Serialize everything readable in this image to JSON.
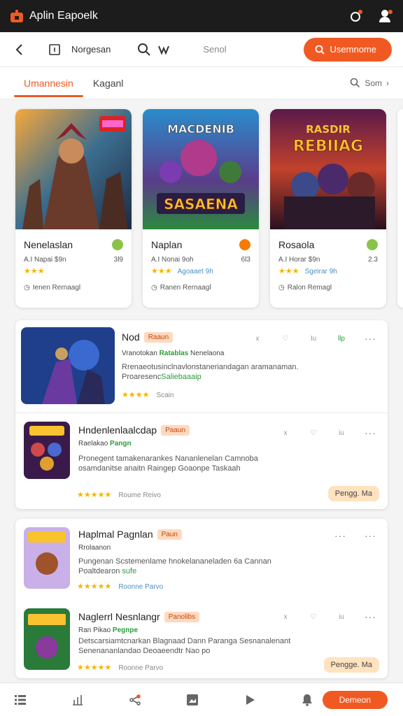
{
  "window": {
    "title": "Aplin Eapoelk",
    "icons": [
      "app-logo-icon",
      "share-icon",
      "user-icon"
    ]
  },
  "toolbar": {
    "nav_label": "Norgesan",
    "search_label": "Senol",
    "cta_label": "Usemnome"
  },
  "tabs": {
    "items": [
      {
        "label": "Umannesin",
        "active": true
      },
      {
        "label": "Kaganl",
        "active": false
      }
    ],
    "sort_label": "Som"
  },
  "featured": [
    {
      "art_title": "",
      "art_tag": "",
      "title": "Nenelaslan",
      "meta": "A.I Napai $9n",
      "count": "3l9",
      "stars": "★★★",
      "link": "",
      "footer": "Ienen Rernaagl",
      "dot_color": "#8bc34a"
    },
    {
      "art_title": "MACDENIB",
      "art_tag": "SASAENA",
      "title": "Naplan",
      "meta": "A.I Nonai 9oh",
      "count": "6l3",
      "stars": "★★★",
      "link": "Agoaaet 9h",
      "footer": "Ranen Rernaagl",
      "dot_color": "#f57c00"
    },
    {
      "art_title": "RASDIR",
      "art_tag": "REBIIAG",
      "title": "Rosaola",
      "meta": "A.I Horar $9n",
      "count": "2.3",
      "stars": "★★★",
      "link": "Sgeirar 9h",
      "footer": "Ralon Remagl",
      "dot_color": "#8bc34a"
    }
  ],
  "list": [
    {
      "title": "Nod",
      "badge": "Raaun",
      "sub_pre": "Vranotokan",
      "sub_green": "Ratablas",
      "sub_post": "Nenelaona",
      "desc": "Rrenaeotusinclnavlonstaneriandagan aramanaman.",
      "desc2_pre": "Proaresenc",
      "desc2_hl": "Saliebaaaip",
      "stars": "★★★★",
      "stars_label": "Scain",
      "actions": [
        "x",
        "♡",
        "Iu",
        "llp"
      ],
      "pill": ""
    },
    {
      "title": "Hndenlenlaalcdap",
      "badge": "Paaun",
      "sub_pre": "Raelakao",
      "sub_green": "Pangn",
      "sub_post": "",
      "desc": "Pronegent tamakenarankes Nananlenelan Camnoba osamdanitse anaitn Raingep Goaonpe Taskaah",
      "desc2_pre": "",
      "desc2_hl": "",
      "stars": "★★★★★",
      "stars_label": "Roume Reivo",
      "actions": [
        "x",
        "♡",
        "iu",
        "···"
      ],
      "pill": "Pengg. Ma"
    },
    {
      "title": "Haplmal Pagnlan",
      "badge": "Paun",
      "sub_pre": "Rrolaanon",
      "sub_green": "",
      "sub_post": "",
      "desc": "Pungenan Scstemenlame hnokelananeladen 6a Cannan Poaltdearon",
      "desc2_pre": "",
      "desc2_hl": "sufe",
      "stars": "★★★★★",
      "stars_label": "Roonne Parvo",
      "actions": [
        "···",
        "···"
      ],
      "pill": ""
    },
    {
      "title": "Naglerrl Nesnlangr",
      "badge": "Panolibs",
      "sub_pre": "Ran Pikao",
      "sub_green": "Pegnpe",
      "sub_post": "",
      "desc": "Detscarsiamtcnarkan Blagnaad Dann Paranga Sesnanalenant Senenananlandao Deoaeendtr Nao po",
      "desc2_pre": "",
      "desc2_hl": "",
      "stars": "★★★★★",
      "stars_label": "Roonne Parvo",
      "actions": [
        "x",
        "♡",
        "iu",
        "···"
      ],
      "pill": "Pengge. Ma"
    }
  ],
  "bottombar": {
    "icons": [
      "grid-icon",
      "chart-icon",
      "share-icon",
      "image-icon",
      "play-icon",
      "bell-icon"
    ],
    "cta_label": "Demeon"
  },
  "colors": {
    "accent": "#f05a22",
    "dark_bar": "#1c1c1c",
    "star": "#f4b400",
    "green": "#2a9d3a"
  }
}
